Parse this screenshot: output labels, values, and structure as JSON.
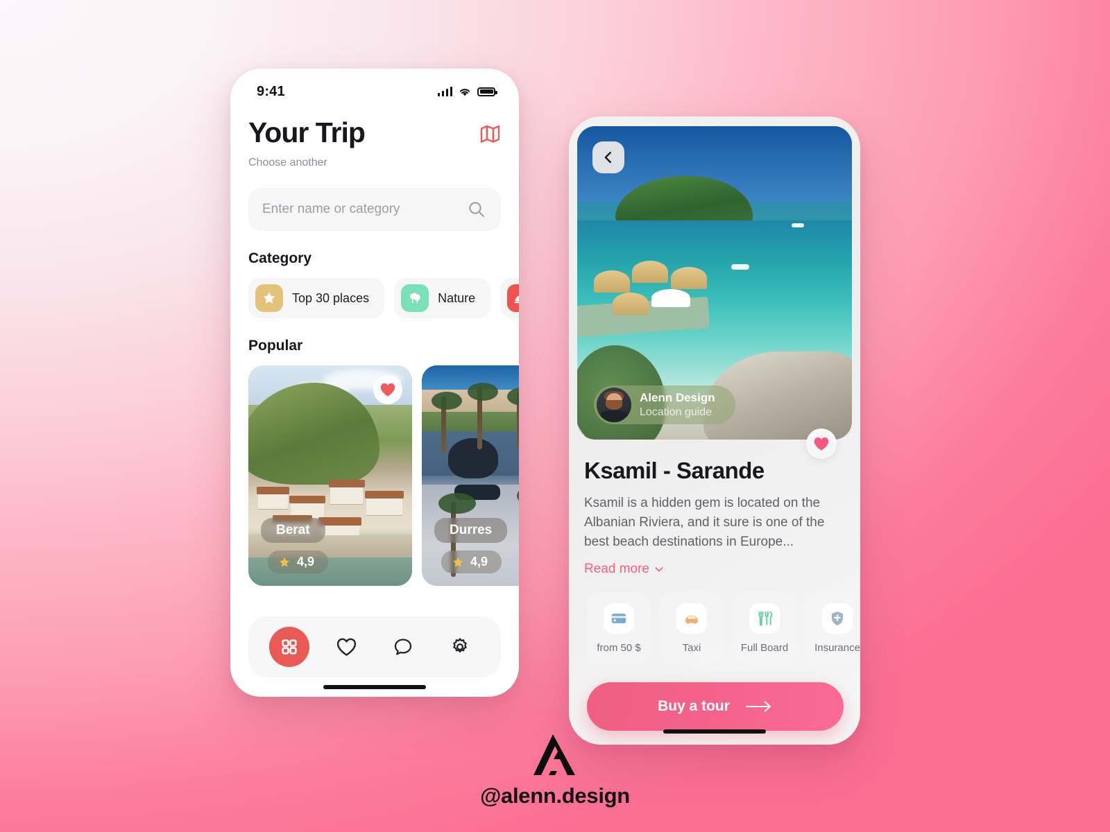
{
  "theme": {
    "accent_pink": "#f4607f",
    "accent_red": "#ea5a55",
    "bg_light": "#fbf7fa",
    "bg_pink": "#fc7290"
  },
  "left_phone": {
    "status_bar": {
      "time": "9:41",
      "signal_icon": "cellular-bars-icon",
      "wifi_icon": "wifi-icon",
      "battery_icon": "battery-icon"
    },
    "header": {
      "title": "Your Trip",
      "subtitle": "Choose another",
      "map_icon": "map-icon"
    },
    "search": {
      "placeholder": "Enter name or category",
      "value": "",
      "icon": "search-icon"
    },
    "category": {
      "section_label": "Category",
      "chips": [
        {
          "label": "Top 30 places",
          "icon": "star-icon",
          "color": "#e3c37a"
        },
        {
          "label": "Nature",
          "icon": "trees-icon",
          "color": "#79e0b8"
        },
        {
          "label": "",
          "icon": "food-cloche-icon",
          "color": "#ef5350"
        }
      ]
    },
    "popular": {
      "section_label": "Popular",
      "cards": [
        {
          "name": "Berat",
          "rating": "4,9",
          "favorite": true,
          "favorite_icon": "heart-filled-icon",
          "star_icon": "star-icon"
        },
        {
          "name": "Durres",
          "rating": "4,9",
          "favorite": false,
          "star_icon": "star-icon"
        }
      ]
    },
    "bottom_nav": {
      "items": [
        {
          "name": "grid-icon",
          "label": "Home",
          "active": true
        },
        {
          "name": "heart-icon",
          "label": "Favorites",
          "active": false
        },
        {
          "name": "chat-bubble-icon",
          "label": "Messages",
          "active": false
        },
        {
          "name": "gear-icon",
          "label": "Settings",
          "active": false
        }
      ]
    }
  },
  "right_phone": {
    "hero": {
      "back_icon": "chevron-left-icon",
      "author_name": "Alenn Design",
      "author_role": "Location guide",
      "avatar": "avatar"
    },
    "favorite": {
      "icon": "heart-filled-icon",
      "active": true
    },
    "detail": {
      "title": "Ksamil - Sarande",
      "description": "Ksamil is a hidden gem is located on the Albanian Riviera, and it sure is one of the best beach destinations in Europe...",
      "read_more": "Read more",
      "read_more_icon": "chevron-down-icon"
    },
    "features": [
      {
        "label": "from 50 $",
        "icon": "credit-card-icon",
        "color": "#7aa8d4"
      },
      {
        "label": "Taxi",
        "icon": "taxi-car-icon",
        "color": "#f5ab6b"
      },
      {
        "label": "Full Board",
        "icon": "cutlery-icon",
        "color": "#5fd09a"
      },
      {
        "label": "Insurance",
        "icon": "shield-plus-icon",
        "color": "#9fb3c4"
      }
    ],
    "cta": {
      "label": "Buy a tour",
      "icon": "arrow-right-icon"
    }
  },
  "watermark": {
    "handle": "@alenn.design",
    "logo": "alenn-a-logo"
  }
}
